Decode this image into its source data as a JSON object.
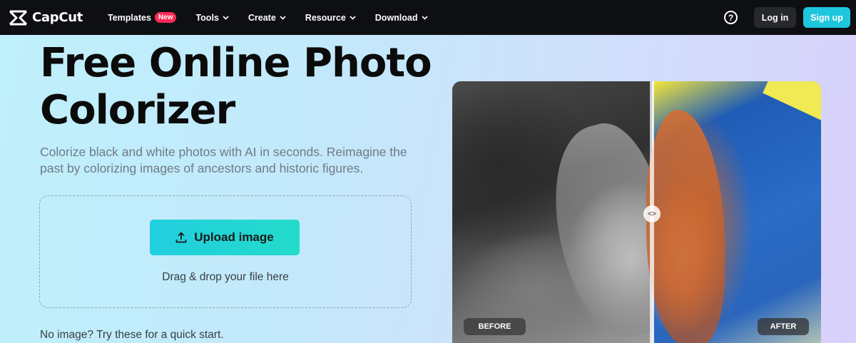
{
  "nav": {
    "logo_text": "CapCut",
    "items": [
      {
        "label": "Templates",
        "badge": "New"
      },
      {
        "label": "Tools"
      },
      {
        "label": "Create"
      },
      {
        "label": "Resource"
      },
      {
        "label": "Download"
      }
    ],
    "help_icon": "?",
    "login_label": "Log in",
    "signup_label": "Sign up"
  },
  "hero": {
    "title_line1": "Free Online Photo",
    "title_line2": "Colorizer",
    "description": "Colorize black and white photos with AI in seconds. Reimagine the past by colorizing images of ancestors and historic figures.",
    "upload_label": "Upload image",
    "drop_hint": "Drag & drop your file here",
    "quick_start": "No image? Try these for a quick start."
  },
  "compare": {
    "before_label": "BEFORE",
    "after_label": "AFTER",
    "handle_glyph": "<>"
  },
  "colors": {
    "nav_bg": "#0e0f12",
    "signup_bg": "#1ec6de",
    "badge_new": "#fe2c55",
    "upload_gradient_start": "#22cfe0",
    "upload_gradient_end": "#23dbc9"
  }
}
